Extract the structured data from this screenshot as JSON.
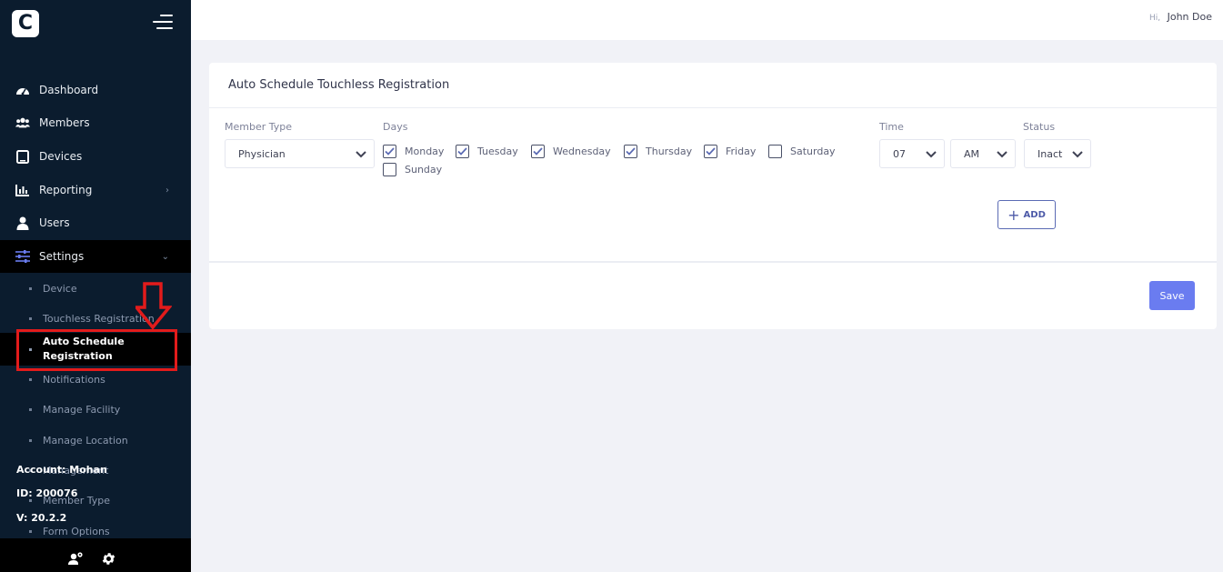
{
  "app": {
    "logo_letter": "C"
  },
  "sidebar": {
    "nav": [
      {
        "label": "Dashboard",
        "icon": "dashboard-gauge-icon"
      },
      {
        "label": "Members",
        "icon": "users-group-icon"
      },
      {
        "label": "Devices",
        "icon": "tablet-icon"
      },
      {
        "label": "Reporting",
        "icon": "bar-chart-icon"
      },
      {
        "label": "Users",
        "icon": "user-icon"
      },
      {
        "label": "Settings",
        "icon": "sliders-icon"
      }
    ],
    "settings_sub": [
      "Device",
      "Touchless Registration",
      "Auto Schedule Registration",
      "Notifications",
      "Manage Facility",
      "Manage Location",
      "Management",
      "Member Type",
      "Form Options"
    ],
    "account_label": "Account: Mohan",
    "id_label": "ID: 200076",
    "version_label": "V: 20.2.2"
  },
  "topbar": {
    "hi": "Hi,",
    "user_name": "John Doe"
  },
  "card": {
    "title": "Auto Schedule Touchless Registration",
    "member_type_label": "Member Type",
    "member_type_value": "Physician",
    "days_label": "Days",
    "days": [
      {
        "label": "Monday",
        "checked": true
      },
      {
        "label": "Tuesday",
        "checked": true
      },
      {
        "label": "Wednesday",
        "checked": true
      },
      {
        "label": "Thursday",
        "checked": true
      },
      {
        "label": "Friday",
        "checked": true
      },
      {
        "label": "Saturday",
        "checked": false
      },
      {
        "label": "Sunday",
        "checked": false
      }
    ],
    "time_label": "Time",
    "hour_value": "07",
    "ampm_value": "AM",
    "status_label": "Status",
    "status_value": "Inact",
    "add_label": "ADD",
    "save_label": "Save"
  },
  "colors": {
    "sidebar_bg": "#0b1c2e",
    "accent": "#6a7cf0",
    "checkbox_check": "#5b6bb4",
    "annotation_red": "#e21b1b"
  }
}
